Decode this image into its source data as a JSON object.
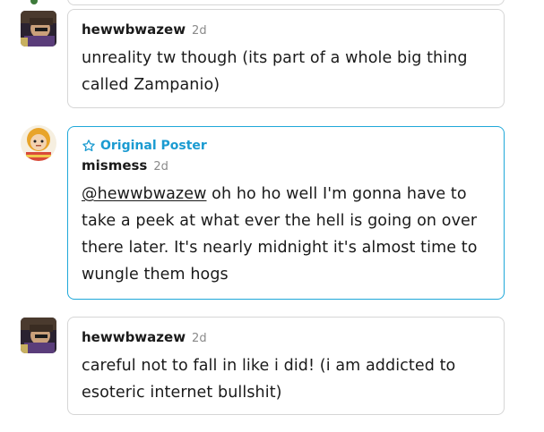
{
  "replies": [
    {
      "username": "hewwbwazew",
      "time": "2d",
      "text": "unreality tw though (its part of a whole big thing called Zampanio)"
    },
    {
      "badge": "Original Poster",
      "username": "mismess",
      "time": "2d",
      "mention": "@hewwbwazew",
      "text": " oh ho ho well I'm gonna have to take a peek at what ever the hell is going on over there later. It's nearly midnight it's almost time to wungle them hogs"
    },
    {
      "username": "hewwbwazew",
      "time": "2d",
      "text": "careful not to fall in like i did! (i am addicted to esoteric internet bullshit)"
    }
  ],
  "colors": {
    "op_accent": "#1b9bd1",
    "border": "#d6d6d6",
    "muted": "#8a8a8a"
  },
  "icons": {
    "op_badge": "star-outline-icon"
  }
}
